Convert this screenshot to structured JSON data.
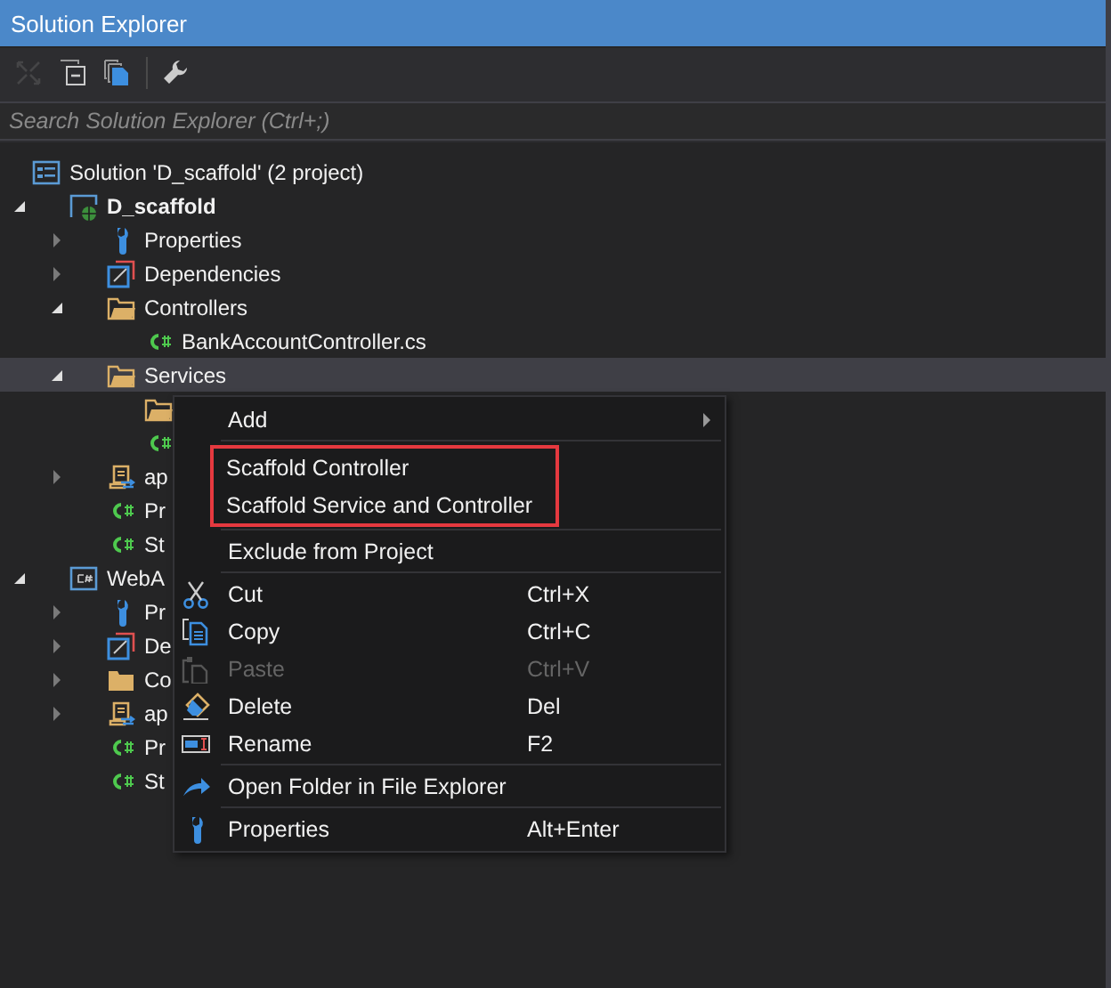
{
  "window": {
    "title": "Solution Explorer"
  },
  "toolbar": [
    {
      "kind": "sync",
      "disabled": true
    },
    {
      "kind": "collapse",
      "disabled": false
    },
    {
      "kind": "show-all",
      "disabled": false
    },
    {
      "kind": "separator"
    },
    {
      "kind": "properties",
      "disabled": false
    }
  ],
  "search": {
    "placeholder": "Search Solution Explorer (Ctrl+;)"
  },
  "tree": [
    {
      "kind": "solution",
      "label": "Solution 'D_scaffold' (2 project)",
      "selected": false,
      "children": [
        {
          "kind": "web-project",
          "label": "D_scaffold",
          "startup": true,
          "expanded": true,
          "selected": false,
          "children": [
            {
              "kind": "properties",
              "label": "Properties",
              "expanded": false,
              "selected": false
            },
            {
              "kind": "dependencies",
              "label": "Dependencies",
              "expanded": false,
              "selected": false
            },
            {
              "kind": "folder",
              "label": "Controllers",
              "expanded": true,
              "selected": false,
              "children": [
                {
                  "kind": "csharp",
                  "label": "BankAccountController.cs",
                  "selected": false
                }
              ]
            },
            {
              "kind": "folder",
              "label": "Services",
              "expanded": true,
              "selected": true,
              "children": [
                {
                  "kind": "folder",
                  "selected": false
                },
                {
                  "kind": "csharp",
                  "selected": false
                }
              ]
            },
            {
              "kind": "config",
              "label": "ap",
              "expanded": false,
              "selected": false
            },
            {
              "kind": "csharp",
              "label": "Pr",
              "selected": false
            },
            {
              "kind": "csharp",
              "label": "St",
              "selected": false
            }
          ]
        },
        {
          "kind": "cs-project",
          "label": "WebA",
          "startup": false,
          "expanded": true,
          "selected": false,
          "children": [
            {
              "kind": "properties",
              "label": "Pr",
              "expanded": false,
              "selected": false
            },
            {
              "kind": "dependencies",
              "label": "De",
              "expanded": false,
              "selected": false
            },
            {
              "kind": "folder-plain",
              "label": "Co",
              "expanded": false,
              "selected": false
            },
            {
              "kind": "config",
              "label": "ap",
              "expanded": false,
              "selected": false
            },
            {
              "kind": "csharp",
              "label": "Pr",
              "selected": false
            },
            {
              "kind": "csharp",
              "label": "St",
              "selected": false
            }
          ]
        }
      ]
    }
  ],
  "context_menu": {
    "groups": [
      {
        "outlined": false,
        "items": [
          {
            "label": "Add",
            "submenu": true,
            "disabled": false
          }
        ]
      },
      {
        "outlined": true,
        "items": [
          {
            "label": "Scaffold Controller",
            "disabled": false
          },
          {
            "label": "Scaffold Service and Controller",
            "disabled": false
          }
        ]
      },
      {
        "outlined": false,
        "items": [
          {
            "label": "Exclude from Project",
            "disabled": false
          }
        ]
      },
      {
        "outlined": false,
        "items": [
          {
            "kind": "cut",
            "label": "Cut",
            "shortcut": "Ctrl+X",
            "disabled": false
          },
          {
            "kind": "copy",
            "label": "Copy",
            "shortcut": "Ctrl+C",
            "disabled": false
          },
          {
            "kind": "paste",
            "label": "Paste",
            "shortcut": "Ctrl+V",
            "disabled": true
          },
          {
            "kind": "delete",
            "label": "Delete",
            "shortcut": "Del",
            "disabled": false
          },
          {
            "kind": "rename",
            "label": "Rename",
            "shortcut": "F2",
            "disabled": false
          }
        ]
      },
      {
        "outlined": false,
        "items": [
          {
            "kind": "open-folder",
            "label": "Open Folder in File Explorer",
            "disabled": false
          }
        ]
      },
      {
        "outlined": false,
        "items": [
          {
            "kind": "properties",
            "label": "Properties",
            "shortcut": "Alt+Enter",
            "disabled": false
          }
        ]
      }
    ]
  }
}
